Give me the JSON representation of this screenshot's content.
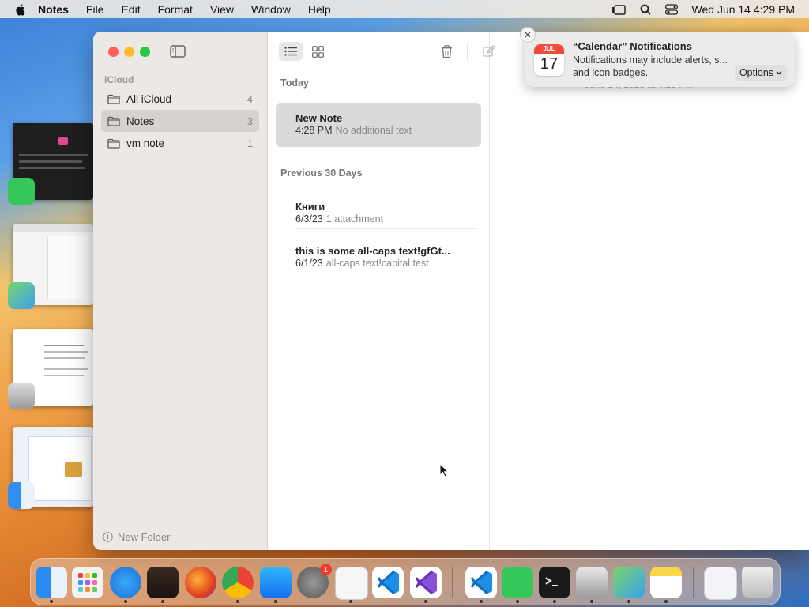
{
  "menubar": {
    "app_name": "Notes",
    "items": [
      "File",
      "Edit",
      "Format",
      "View",
      "Window",
      "Help"
    ],
    "clock": "Wed Jun 14  4:29 PM"
  },
  "sidebar": {
    "section_label": "iCloud",
    "folders": [
      {
        "label": "All iCloud",
        "count": "4"
      },
      {
        "label": "Notes",
        "count": "3"
      },
      {
        "label": "vm note",
        "count": "1"
      }
    ],
    "new_folder_label": "New Folder"
  },
  "note_list": {
    "groups": [
      {
        "heading": "Today",
        "notes": [
          {
            "title": "New Note",
            "date": "4:28 PM",
            "preview": "No additional text"
          }
        ]
      },
      {
        "heading": "Previous 30 Days",
        "notes": [
          {
            "title": "Книги",
            "date": "6/3/23",
            "preview": "1 attachment"
          },
          {
            "title": "this is some all-caps text!gfGt...",
            "date": "6/1/23",
            "preview": "all-caps text!capital test"
          }
        ]
      }
    ]
  },
  "editor": {
    "timestamp_partial": "June 14, 2023 at 4:28 PM"
  },
  "notification": {
    "calendar_month": "JUL",
    "calendar_day": "17",
    "title": "“Calendar” Notifications",
    "body": "Notifications may include alerts, s... and icon badges.",
    "options_label": "Options",
    "close_glyph": "✕"
  },
  "dock": {
    "settings_badge": "1"
  },
  "colors": {
    "close": "#ff5f57",
    "minimize": "#febc2e",
    "zoom": "#28c840"
  }
}
